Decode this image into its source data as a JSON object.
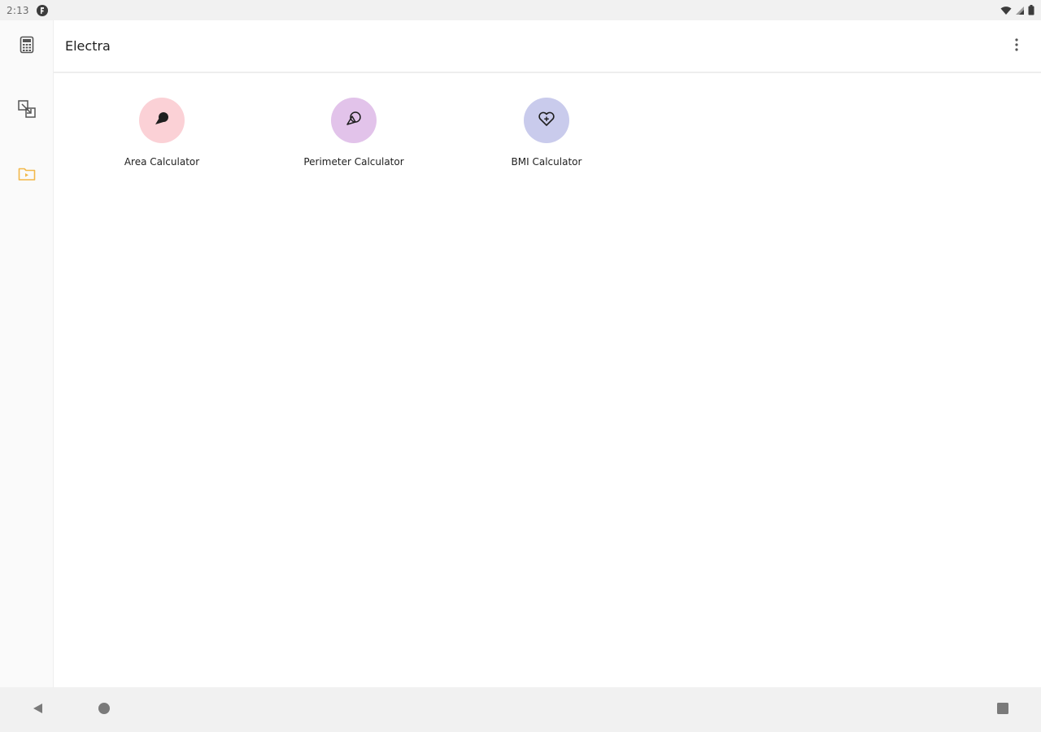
{
  "status_bar": {
    "time": "2:13",
    "icons": [
      "app-notification-icon",
      "wifi-icon",
      "cell-signal-icon",
      "battery-icon"
    ]
  },
  "nav_rail": {
    "items": [
      {
        "name": "calculator",
        "icon": "calculator-icon",
        "selected": false
      },
      {
        "name": "converter",
        "icon": "unit-converter-icon",
        "selected": false
      },
      {
        "name": "folder",
        "icon": "folder-icon",
        "selected": true
      }
    ],
    "accent_color": "#f2b84b"
  },
  "app_bar": {
    "title": "Electra",
    "overflow_icon": "more-vert-icon"
  },
  "tools": [
    {
      "label": "Area Calculator",
      "icon": "area-icon",
      "color": "#fbd1d6"
    },
    {
      "label": "Perimeter Calculator",
      "icon": "perimeter-icon",
      "color": "#e2c3ea"
    },
    {
      "label": "BMI Calculator",
      "icon": "heart-icon",
      "color": "#c9cbec"
    }
  ],
  "system_nav": {
    "icons": [
      "back-icon",
      "home-icon",
      "recents-icon"
    ]
  }
}
